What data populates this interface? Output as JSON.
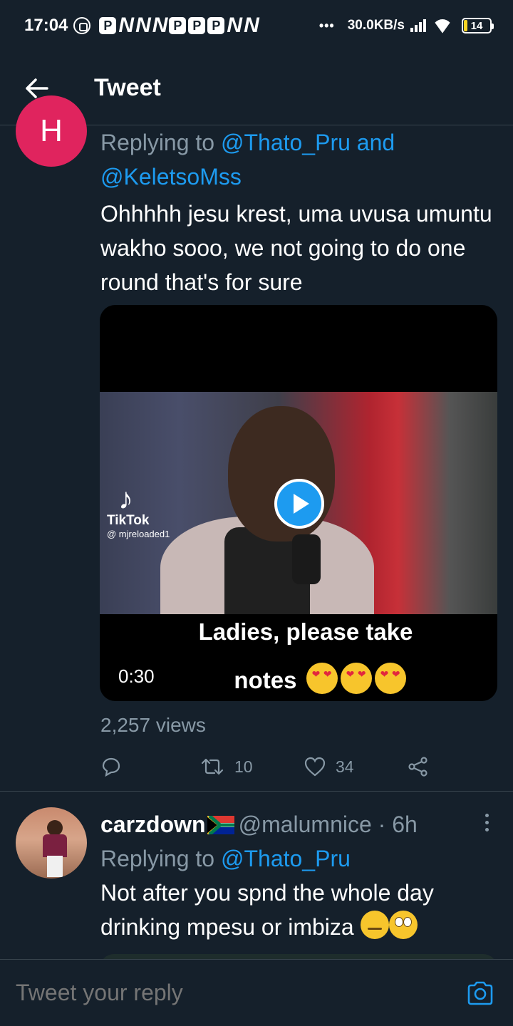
{
  "status_bar": {
    "time": "17:04",
    "notification_p": "P",
    "notification_n": "N",
    "net_speed": "30.0KB/s",
    "battery": "14",
    "battery_level": 0.14
  },
  "header": {
    "title": "Tweet"
  },
  "tweet_1": {
    "avatar_letter": "H",
    "avatar_color": "#e0245e",
    "replying_prefix": "Replying to ",
    "mention_1": "@Thato_Pru",
    "and": " and",
    "mention_2": "@KeletsoMss",
    "text": "Ohhhhh jesu krest, uma uvusa umuntu wakho sooo, we not going to do one round that's for sure",
    "media": {
      "tiktok_name": "TikTok",
      "tiktok_handle": "@ mjreloaded1",
      "caption_line_1": "Ladies, please take",
      "caption_line_2": "notes",
      "duration": "0:30"
    },
    "views": "2,257 views",
    "retweets": "10",
    "likes": "34"
  },
  "tweet_2": {
    "display_name": "carzdown",
    "handle_time": "@malumnice · 6h",
    "replying_prefix": "Replying to ",
    "mention": "@Thato_Pru",
    "text": "Not after you spnd  the whole day drinking  mpesu or imbiza"
  },
  "reply_bar": {
    "placeholder": "Tweet your reply"
  },
  "colors": {
    "background": "#15202b",
    "accent": "#1d9bf0",
    "muted": "#8899a6",
    "divider": "#38444d"
  }
}
